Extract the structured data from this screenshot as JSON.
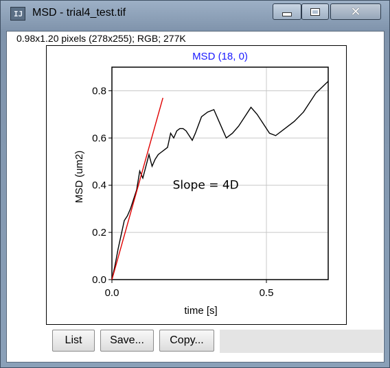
{
  "window": {
    "title": "MSD - trial4_test.tif",
    "app_icon_text": "IJ",
    "min_icon": "minimize-icon",
    "max_icon": "maximize-icon",
    "close_icon": "close-icon"
  },
  "info_line": "0.98x1.20 pixels (278x255); RGB; 277K",
  "buttons": {
    "list": "List",
    "save": "Save...",
    "copy": "Copy..."
  },
  "chart_data": {
    "type": "line",
    "title": "MSD (18, 0)",
    "xlabel": "time [s]",
    "ylabel": "MSD (um2)",
    "annotation": "Slope = 4D",
    "xlim": [
      0.0,
      0.7
    ],
    "ylim": [
      0.0,
      0.9
    ],
    "xticks": [
      0.0,
      0.5
    ],
    "xtick_labels": [
      "0.0",
      "0.5"
    ],
    "yticks": [
      0.0,
      0.2,
      0.4,
      0.6,
      0.8
    ],
    "ytick_labels": [
      "0.0",
      "0.2",
      "0.4",
      "0.6",
      "0.8"
    ],
    "grid": true,
    "title_color": "#1a1aff",
    "series": [
      {
        "color": "#000000",
        "x": [
          0.0,
          0.01,
          0.02,
          0.03,
          0.04,
          0.05,
          0.06,
          0.07,
          0.08,
          0.09,
          0.1,
          0.11,
          0.12,
          0.13,
          0.14,
          0.15,
          0.16,
          0.17,
          0.18,
          0.19,
          0.2,
          0.21,
          0.22,
          0.23,
          0.24,
          0.25,
          0.26,
          0.27,
          0.29,
          0.31,
          0.33,
          0.35,
          0.37,
          0.39,
          0.41,
          0.43,
          0.45,
          0.47,
          0.49,
          0.51,
          0.53,
          0.56,
          0.59,
          0.62,
          0.66,
          0.7
        ],
        "y": [
          0.0,
          0.06,
          0.13,
          0.19,
          0.25,
          0.27,
          0.3,
          0.34,
          0.38,
          0.46,
          0.43,
          0.48,
          0.53,
          0.48,
          0.51,
          0.53,
          0.54,
          0.55,
          0.56,
          0.62,
          0.6,
          0.63,
          0.64,
          0.64,
          0.63,
          0.61,
          0.59,
          0.62,
          0.69,
          0.71,
          0.72,
          0.66,
          0.6,
          0.62,
          0.65,
          0.69,
          0.73,
          0.7,
          0.66,
          0.62,
          0.61,
          0.64,
          0.67,
          0.71,
          0.79,
          0.84
        ]
      },
      {
        "color": "#e00000",
        "x": [
          0.0,
          0.165
        ],
        "y": [
          0.0,
          0.77
        ]
      }
    ]
  }
}
